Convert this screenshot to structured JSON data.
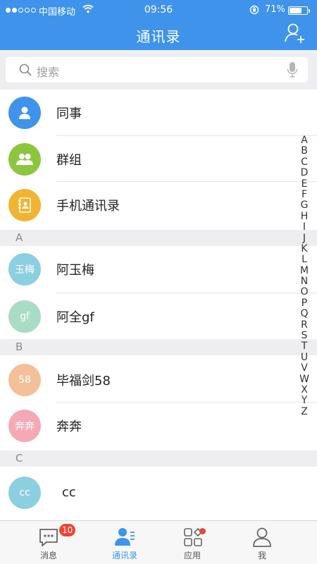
{
  "status_bar": {
    "carrier": "中国移动",
    "time": "09:56",
    "battery": "71%",
    "battery_level": 0.71
  },
  "header": {
    "title": "通讯录"
  },
  "search": {
    "placeholder": "搜索"
  },
  "quick_entries": [
    {
      "label": "同事",
      "icon": "person-icon",
      "color": "#3f93ea"
    },
    {
      "label": "群组",
      "icon": "group-icon",
      "color": "#8cc63f"
    },
    {
      "label": "手机通讯录",
      "icon": "address-book-icon",
      "color": "#f0b432"
    }
  ],
  "sections": [
    {
      "letter": "A",
      "contacts": [
        {
          "name": "阿玉梅",
          "avatar_text": "玉梅",
          "color": "#8ccfe0"
        },
        {
          "name": "阿全gf",
          "avatar_text": "gf",
          "color": "#a9dcc4"
        }
      ]
    },
    {
      "letter": "B",
      "contacts": [
        {
          "name": "毕福剑58",
          "avatar_text": "58",
          "color": "#f3c09a"
        },
        {
          "name": "奔奔",
          "avatar_text": "奔奔",
          "color": "#f4a9b5"
        }
      ]
    },
    {
      "letter": "C",
      "contacts": [
        {
          "name": "cc",
          "avatar_text": "cc",
          "color": "#8ccfe0"
        }
      ]
    }
  ],
  "index_letters": [
    "A",
    "B",
    "C",
    "D",
    "E",
    "F",
    "G",
    "H",
    "I",
    "J",
    "K",
    "L",
    "M",
    "N",
    "O",
    "P",
    "Q",
    "R",
    "S",
    "T",
    "U",
    "V",
    "W",
    "X",
    "Y",
    "Z"
  ],
  "tabs": [
    {
      "label": "消息",
      "icon": "chat-bubble-icon",
      "badge": "10"
    },
    {
      "label": "通讯录",
      "icon": "contacts-icon",
      "active": true
    },
    {
      "label": "应用",
      "icon": "apps-grid-icon",
      "dot": true
    },
    {
      "label": "我",
      "icon": "user-icon"
    }
  ],
  "colors": {
    "brand": "#3f93ea",
    "badge": "#ee4431",
    "section_bg": "#eeeef1"
  }
}
